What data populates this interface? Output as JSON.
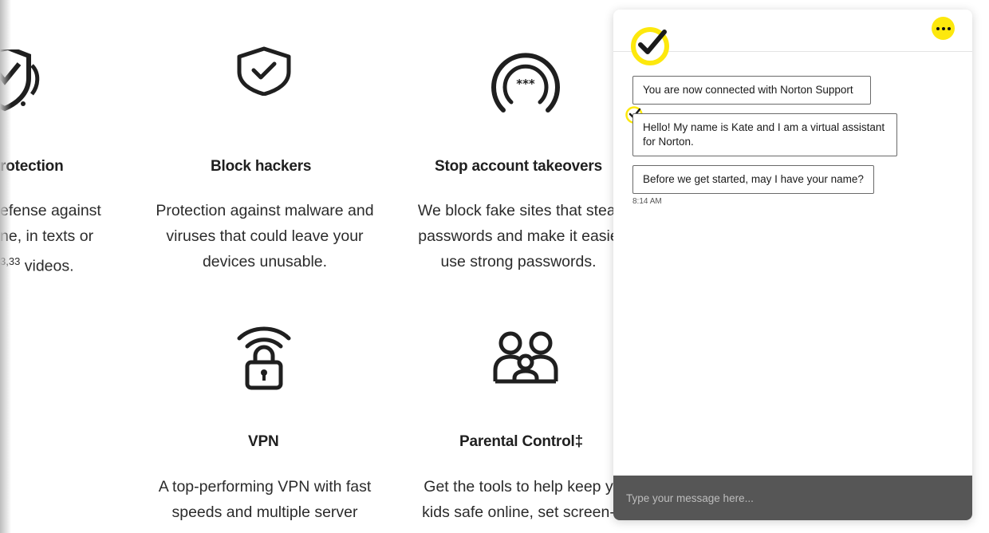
{
  "features": [
    {
      "id": "protection",
      "title": "rotection",
      "lines": [
        "efense against",
        "ne, in texts or"
      ],
      "line3_sup": "3,33",
      "line3_text": " videos."
    },
    {
      "id": "block-hackers",
      "title": "Block hackers",
      "lines": [
        "Protection against malware and",
        "viruses that could leave your",
        "devices unusable."
      ]
    },
    {
      "id": "stop-takeovers",
      "title": "Stop account takeovers",
      "lines": [
        "We block fake sites that steal",
        "passwords and make it easie",
        "use strong passwords."
      ]
    },
    {
      "id": "vpn",
      "title": "VPN",
      "lines": [
        "A top-performing VPN with fast",
        "speeds and multiple server"
      ]
    },
    {
      "id": "parental",
      "title": "Parental Control‡",
      "lines": [
        "Get the tools to help keep y",
        "kids safe online, set screen-"
      ]
    }
  ],
  "icons": {
    "shield_partial": "shield-icon",
    "shield": "shield-check-icon",
    "password": "password-icon",
    "vpn": "wifi-lock-icon",
    "family": "family-icon"
  },
  "chat": {
    "menu_icon": "more-icon",
    "messages": [
      "You are now connected with Norton Support",
      "Hello! My name is Kate and I am a virtual assistant for Norton.",
      "Before we get started, may I have your name?"
    ],
    "timestamp": "8:14 AM",
    "input_placeholder": "Type your message here...",
    "colors": {
      "accent": "#fde80d",
      "composer": "#565656"
    }
  }
}
